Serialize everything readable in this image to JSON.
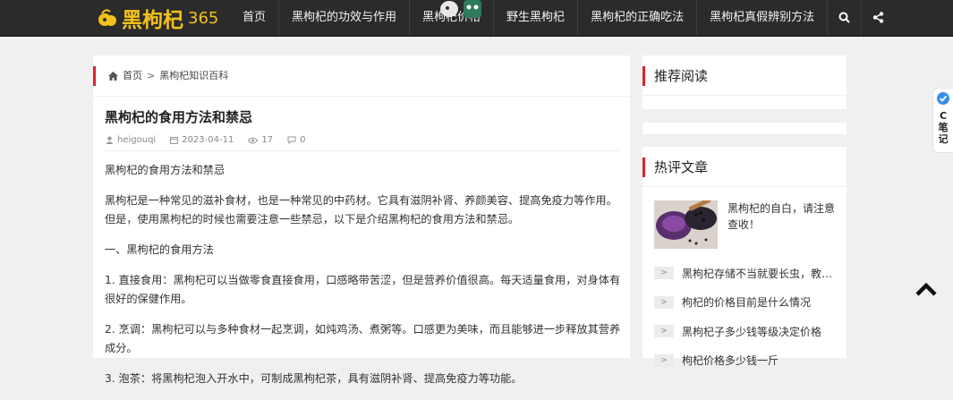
{
  "header": {
    "logo_text": "黑枸杞",
    "logo_suffix": "365",
    "nav": [
      "首页",
      "黑枸杞的功效与作用",
      "黑枸杞价格",
      "野生黑枸杞",
      "黑枸杞的正确吃法",
      "黑枸杞真假辨别方法"
    ],
    "icons": [
      "search-icon",
      "share-icon"
    ]
  },
  "breadcrumb": {
    "home": "首页",
    "sep": ">",
    "category": "黑枸杞知识百科"
  },
  "post": {
    "title": "黑枸杞的食用方法和禁忌",
    "author": "heigouqi",
    "date": "2023-04-11",
    "views": "17",
    "comments": "0",
    "paragraphs": [
      "黑枸杞的食用方法和禁忌",
      "黑枸杞是一种常见的滋补食材，也是一种常见的中药材。它具有滋阴补肾、养颜美容、提高免疫力等作用。但是，使用黑枸杞的时候也需要注意一些禁忌，以下是介绍黑枸杞的食用方法和禁忌。",
      "一、黑枸杞的食用方法",
      "1. 直接食用：黑枸杞可以当做零食直接食用，口感略带苦涩，但是营养价值很高。每天适量食用，对身体有很好的保健作用。",
      "2. 烹调：黑枸杞可以与多种食材一起烹调，如炖鸡汤、煮粥等。口感更为美味，而且能够进一步释放其营养成分。",
      "3. 泡茶：将黑枸杞泡入开水中，可制成黑枸杞茶，具有滋阴补肾、提高免疫力等功能。"
    ]
  },
  "sidebar": {
    "recommend_title": "推荐阅读",
    "hot_title": "热评文章",
    "hot_first": "黑枸杞的自白，请注意查收！",
    "hot_list": [
      {
        "num": ">",
        "text": "黑枸杞存储不当就要长虫，教你..."
      },
      {
        "num": ">",
        "text": "枸杞的价格目前是什么情况"
      },
      {
        "num": ">",
        "text": "黑枸杞子多少钱等级决定价格"
      },
      {
        "num": ">",
        "text": "枸杞价格多少钱一斤"
      }
    ]
  },
  "float": {
    "csdn_letter": "C",
    "csdn_label_1": "笔",
    "csdn_label_2": "记"
  },
  "colors": {
    "topbar": "#2b2b2b",
    "accent": "#d9232d",
    "logo": "#f3c21a"
  }
}
